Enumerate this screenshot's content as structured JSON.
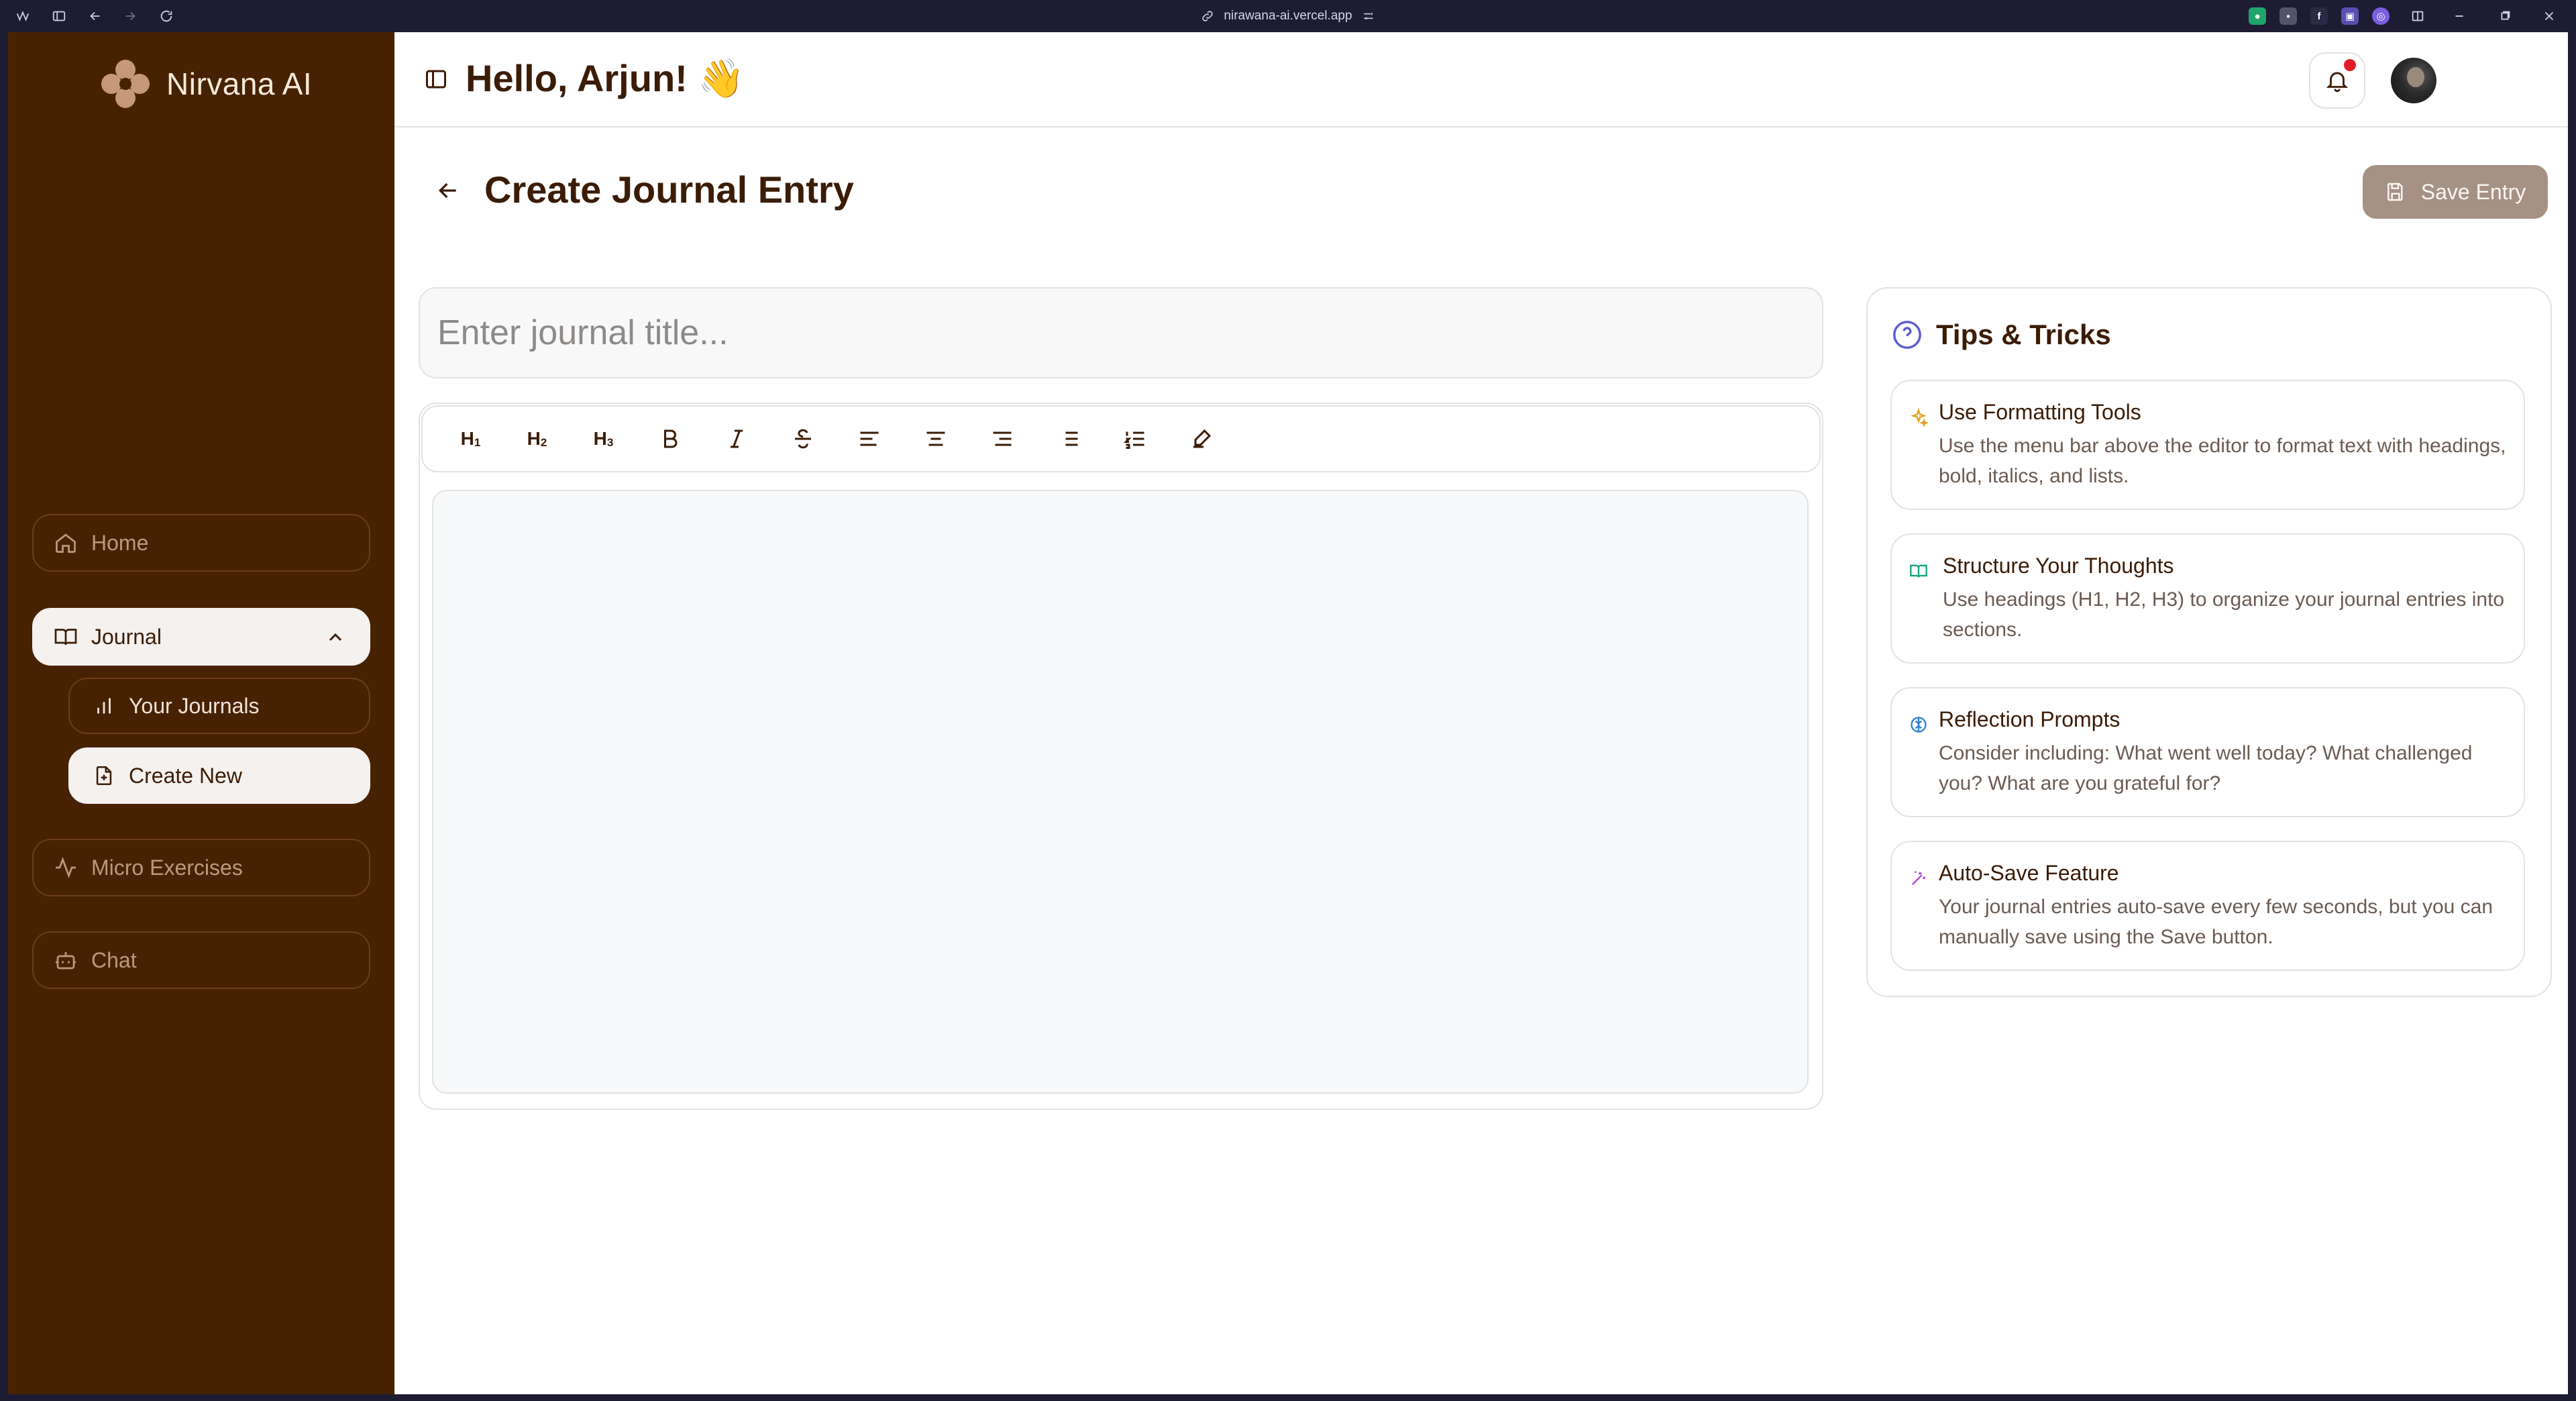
{
  "browser": {
    "url": "nirawana-ai.vercel.app"
  },
  "sidebar": {
    "brand": "Nirvana AI",
    "items": [
      {
        "label": "Home",
        "icon": "home-icon"
      },
      {
        "label": "Journal",
        "icon": "book-icon"
      },
      {
        "label": "Micro Exercises",
        "icon": "activity-icon"
      },
      {
        "label": "Chat",
        "icon": "bot-icon"
      }
    ],
    "journal_sub": [
      {
        "label": "Your Journals",
        "icon": "bar-chart-icon"
      },
      {
        "label": "Create New",
        "icon": "file-plus-icon"
      }
    ]
  },
  "header": {
    "greeting": "Hello, Arjun! 👋"
  },
  "page": {
    "title": "Create Journal Entry",
    "save_label": "Save Entry",
    "title_placeholder": "Enter journal title..."
  },
  "toolbar": {
    "buttons": [
      "heading-1",
      "heading-2",
      "heading-3",
      "bold",
      "italic",
      "strikethrough",
      "align-left",
      "align-center",
      "align-right",
      "bullet-list",
      "ordered-list",
      "clear-format"
    ]
  },
  "tips": {
    "title": "Tips & Tricks",
    "items": [
      {
        "title": "Use Formatting Tools",
        "desc": "Use the menu bar above the editor to format text with headings, bold, italics, and lists.",
        "color": "#e0a21b"
      },
      {
        "title": "Structure Your Thoughts",
        "desc": "Use headings (H1, H2, H3) to organize your journal entries into sections.",
        "color": "#10a37f"
      },
      {
        "title": "Reflection Prompts",
        "desc": "Consider including: What went well today? What challenged you? What are you grateful for?",
        "color": "#2f7fd6"
      },
      {
        "title": "Auto-Save Feature",
        "desc": "Your journal entries auto-save every few seconds, but you can manually save using the Save button.",
        "color": "#b043d6"
      }
    ]
  },
  "colors": {
    "sidebar_bg": "#472202",
    "accent_text": "#3b1c06",
    "save_button": "#a69185",
    "notification": "#e11d2a"
  }
}
